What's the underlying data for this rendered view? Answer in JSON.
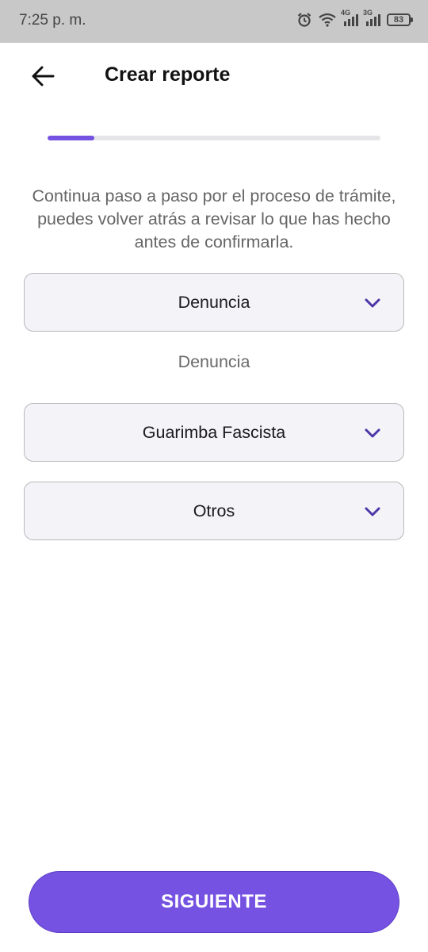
{
  "status_bar": {
    "time": "7:25 p. m.",
    "network_1": "4G",
    "network_2": "3G",
    "battery": "83"
  },
  "header": {
    "title": "Crear reporte",
    "back_icon": "arrow-left-icon"
  },
  "progress": {
    "fraction": 0.14,
    "color": "#7552e2"
  },
  "description": "Continua paso a paso por el proceso de trámite, puedes volver atrás a revisar lo que has hecho antes de confirmarla.",
  "fields": {
    "type_select": {
      "value": "Denuncia"
    },
    "type_label": "Denuncia",
    "category_select": {
      "value": "Guarimba Fascista"
    },
    "subcategory_select": {
      "value": "Otros"
    }
  },
  "actions": {
    "next_label": "SIGUIENTE"
  },
  "colors": {
    "accent": "#7552e2",
    "status_bar_bg": "#c8c8c8"
  }
}
